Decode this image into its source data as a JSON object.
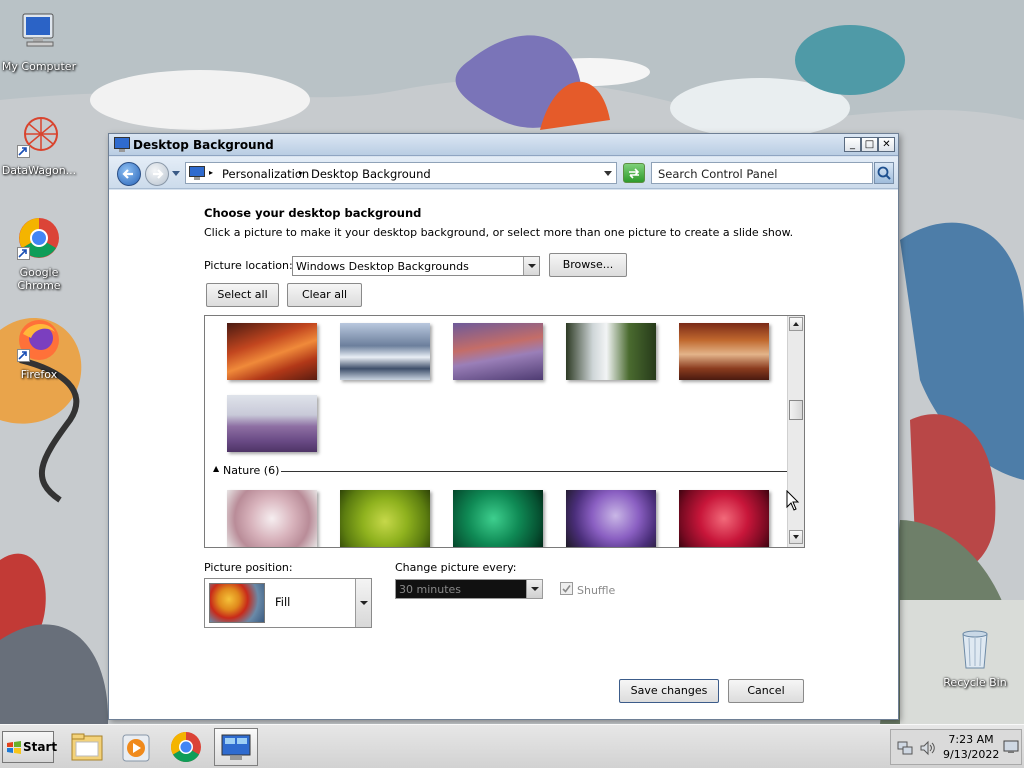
{
  "desktop": {
    "icons": [
      {
        "label": "My Computer",
        "icon": "computer-icon"
      },
      {
        "label": "DataWagon...",
        "icon": "datawagon-icon"
      },
      {
        "label": "Google Chrome",
        "icon": "chrome-icon"
      },
      {
        "label": "Firefox",
        "icon": "firefox-icon"
      },
      {
        "label": "Recycle Bin",
        "icon": "recycle-bin-icon"
      }
    ]
  },
  "window": {
    "title": "Desktop Background",
    "controls": {
      "minimize": "_",
      "maximize": "□",
      "close": "✕"
    },
    "breadcrumb": [
      "Personalization",
      "Desktop Background"
    ],
    "search_placeholder": "Search Control Panel"
  },
  "panel": {
    "heading": "Choose your desktop background",
    "instructions": "Click a picture to make it your desktop background, or select more than one picture to create a slide show.",
    "picture_location_label": "Picture location:",
    "picture_location_value": "Windows Desktop Backgrounds",
    "browse_label": "Browse...",
    "select_all_label": "Select all",
    "clear_all_label": "Clear all",
    "group_name": "Nature (6)",
    "picture_position_label": "Picture position:",
    "picture_position_value": "Fill",
    "change_picture_label": "Change picture every:",
    "change_picture_value": "30 minutes",
    "shuffle_label": "Shuffle",
    "shuffle_checked": true,
    "save_label": "Save changes",
    "cancel_label": "Cancel"
  },
  "taskbar": {
    "start_label": "Start",
    "apps": [
      "file-explorer-icon",
      "media-player-icon",
      "chrome-icon",
      "control-panel-icon"
    ],
    "time": "7:23 AM",
    "date": "9/13/2022"
  }
}
